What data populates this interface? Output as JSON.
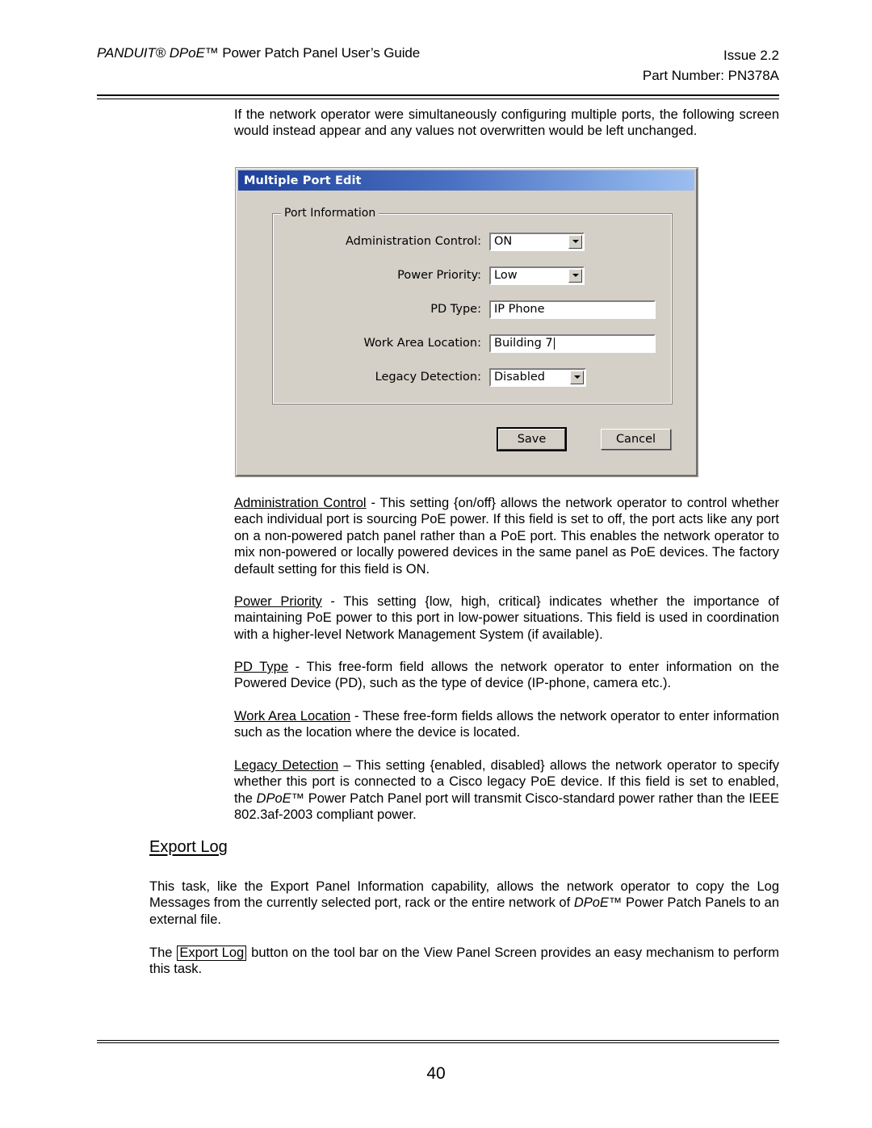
{
  "header": {
    "title_italic": "PANDUIT® DPoE™",
    "title_rest": " Power Patch Panel User’s Guide",
    "issue": "Issue 2.2",
    "part_number": "Part Number: PN378A"
  },
  "intro_paragraph": "If the network operator were simultaneously configuring multiple ports, the following screen would instead appear and any values not overwritten would be left unchanged.",
  "dialog": {
    "title": "Multiple Port Edit",
    "group_label": "Port Information",
    "fields": [
      {
        "label": "Administration Control:",
        "type": "combo",
        "value": "ON"
      },
      {
        "label": "Power Priority:",
        "type": "combo",
        "value": "Low"
      },
      {
        "label": "PD Type:",
        "type": "text",
        "value": "IP Phone"
      },
      {
        "label": "Work Area Location:",
        "type": "text",
        "value": "Building 7"
      },
      {
        "label": "Legacy Detection:",
        "type": "combo",
        "value": "Disabled"
      }
    ],
    "save_label": "Save",
    "cancel_label": "Cancel"
  },
  "definitions": [
    {
      "term": "Administration Control",
      "body": " - This setting {on/off} allows the network operator to control whether each individual port is sourcing PoE power.  If this field is set to off, the port acts like any port on a non-powered patch panel rather than a PoE port. This enables the network operator to mix non-powered or locally powered devices in the same panel as PoE devices. The factory default setting for this field is ON."
    },
    {
      "term": "Power Priority",
      "body": " - This setting {low, high, critical} indicates whether the importance of maintaining PoE power to this port in low-power situations.  This field is used in coordination with a higher-level Network Management System (if available)."
    },
    {
      "term": "PD Type",
      "body": " - This free-form field allows the network operator to enter information on the Powered Device (PD), such as the type of device (IP-phone, camera etc.)."
    },
    {
      "term": "Work Area Location",
      "body": " - These free-form fields allows the network operator to enter information such as the location where the device is located."
    }
  ],
  "legacy_detection": {
    "term": "Legacy Detection",
    "part1": " – This setting {enabled, disabled} allows the network operator to specify whether this port is connected to a Cisco legacy PoE device.  If this field is set to enabled, the ",
    "italic": "DPoE™",
    "part2": " Power Patch Panel port will transmit Cisco-standard power rather than the IEEE 802.3af-2003 compliant power."
  },
  "section": {
    "heading": "Export Log",
    "paragraph1_part1": "This task, like the Export Panel Information capability, allows the network operator to copy the Log Messages from the currently selected port, rack or the entire network of ",
    "paragraph1_italic": "DPoE™",
    "paragraph1_part2": " Power Patch Panels to an external file.",
    "paragraph2_part1": "The ",
    "paragraph2_boxed": "Export Log",
    "paragraph2_part2": " button on the tool bar on the View Panel Screen provides an easy mechanism to perform this task."
  },
  "footer": {
    "page_number": "40"
  }
}
